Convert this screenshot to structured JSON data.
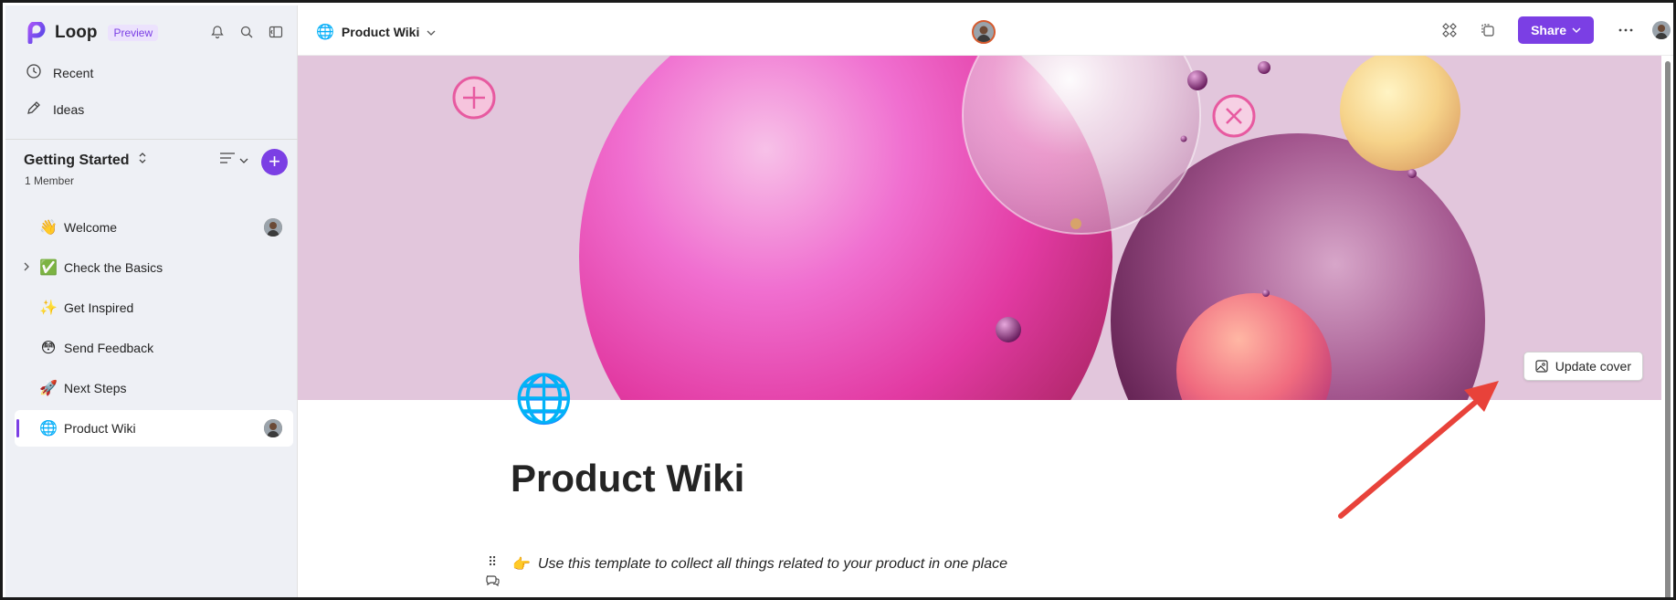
{
  "app": {
    "name": "Loop",
    "badge": "Preview"
  },
  "sidebar": {
    "nav": [
      {
        "label": "Recent",
        "icon": "clock-icon"
      },
      {
        "label": "Ideas",
        "icon": "pen-icon"
      }
    ],
    "workspace": {
      "title": "Getting Started",
      "members": "1 Member"
    },
    "pages": [
      {
        "emoji": "👋",
        "label": "Welcome",
        "has_avatar": true
      },
      {
        "emoji": "✅",
        "label": "Check the Basics",
        "expandable": true
      },
      {
        "emoji": "✨",
        "label": "Get Inspired"
      },
      {
        "emoji": "😳",
        "label": "Send Feedback"
      },
      {
        "emoji": "🚀",
        "label": "Next Steps"
      },
      {
        "emoji": "🌐",
        "label": "Product Wiki",
        "has_avatar": true,
        "active": true
      }
    ]
  },
  "header": {
    "breadcrumb": "Product Wiki",
    "share_label": "Share"
  },
  "cover": {
    "update_label": "Update cover"
  },
  "content": {
    "page_icon": "🌐",
    "title": "Product Wiki",
    "description_emoji": "👉",
    "description": "Use this template to collect all things related to your product in one place"
  },
  "colors": {
    "accent": "#7b3fe4",
    "annotation_arrow": "#e8423a"
  }
}
